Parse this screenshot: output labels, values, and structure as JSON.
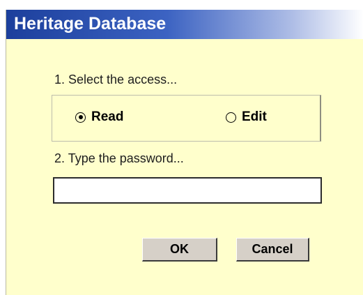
{
  "dialog": {
    "title": "Heritage Database"
  },
  "access": {
    "label": "1. Select the access...",
    "options": [
      {
        "label": "Read",
        "selected": true
      },
      {
        "label": "Edit",
        "selected": false
      }
    ]
  },
  "password": {
    "label": "2. Type the password...",
    "value": "",
    "placeholder": ""
  },
  "buttons": {
    "ok_label": "OK",
    "cancel_label": "Cancel"
  },
  "colors": {
    "dialog_background": "#ffffcc",
    "titlebar_start": "#1c3f9c",
    "button_face": "#d6d0c8"
  }
}
